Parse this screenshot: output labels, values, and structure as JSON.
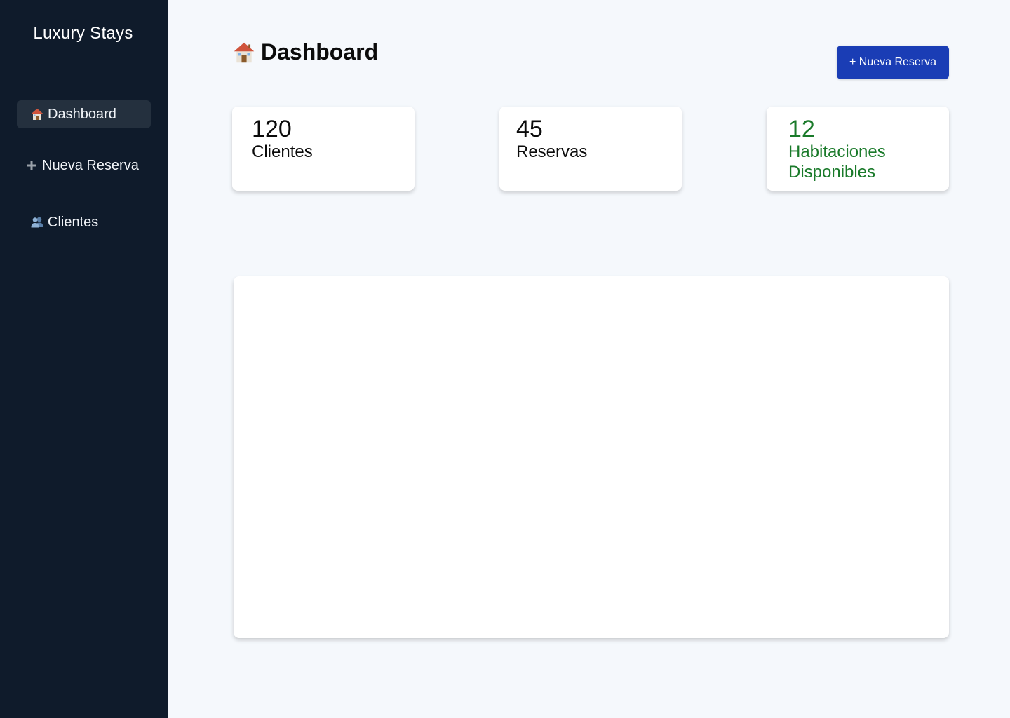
{
  "sidebar": {
    "brand": "Luxury Stays",
    "items": [
      {
        "label": "Dashboard",
        "icon": "house-icon",
        "active": true
      },
      {
        "label": "Nueva Reserva",
        "icon": "plus-icon",
        "active": false
      },
      {
        "label": "Clientes",
        "icon": "people-icon",
        "active": false
      }
    ]
  },
  "header": {
    "title": "Dashboard",
    "title_icon": "house-icon",
    "new_reservation_label": "+ Nueva Reserva"
  },
  "stats": [
    {
      "value": "120",
      "label": "Clientes",
      "color": "#0b0b0b"
    },
    {
      "value": "45",
      "label": "Reservas",
      "color": "#0b0b0b"
    },
    {
      "value": "12",
      "label": "Habitaciones Disponibles",
      "color": "#1a7a2a"
    }
  ],
  "colors": {
    "sidebar_bg": "#0f1b2b",
    "active_item_bg": "#24303e",
    "page_bg": "#f5f8fc",
    "primary": "#1a3db5",
    "success": "#1a7a2a"
  }
}
